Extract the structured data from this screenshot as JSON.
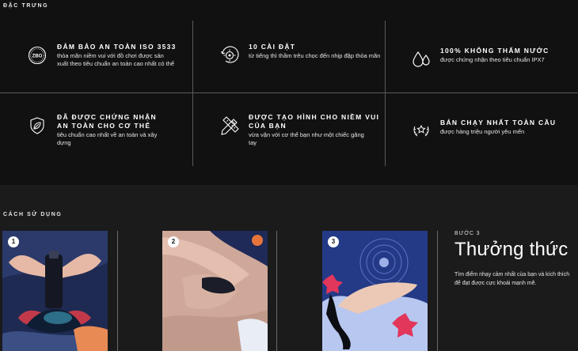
{
  "features_section": {
    "label": "ĐẶC TRƯNG",
    "items": [
      {
        "icon": "zbo-badge-icon",
        "title": "ĐẢM BẢO AN TOÀN ISO 3533",
        "desc": "thỏa mãn niềm vui với đồ chơi được sản xuất theo tiêu chuẩn an toàn cao nhất có thể",
        "badge_text": "ZBO"
      },
      {
        "icon": "settings-dial-icon",
        "title": "10 CÀI ĐẶT",
        "desc": "từ tiếng thì thầm trêu chọc đến nhịp đập thỏa mãn"
      },
      {
        "icon": "water-drops-icon",
        "title": "100% KHÔNG THẤM NƯỚC",
        "desc": "được chứng nhận theo tiêu chuẩn IPX7"
      },
      {
        "icon": "shield-leaf-icon",
        "title": "ĐÃ ĐƯỢC CHỨNG NHẬN AN TOÀN CHO CƠ THỂ",
        "desc": "tiêu chuẩn cao nhất về an toàn và xây dựng"
      },
      {
        "icon": "pencil-ruler-icon",
        "title": "ĐƯỢC TẠO HÌNH CHO NIỀM VUI CỦA BẠN",
        "desc": "vừa vặn với cơ thể bạn như một chiếc găng tay"
      },
      {
        "icon": "laurel-star-icon",
        "title": "BÁN CHẠY NHẤT TOÀN CẦU",
        "desc": "được hàng triệu người yêu mến"
      }
    ]
  },
  "usage_section": {
    "label": "CÁCH SỬ DỤNG",
    "steps": [
      {
        "badge": "1"
      },
      {
        "badge": "2"
      },
      {
        "badge": "3"
      }
    ],
    "caption": {
      "step_num": "BƯỚC 3",
      "title": "Thưởng thức",
      "desc": "Tìm điểm nhạy cảm nhất của bạn và kích thích để đạt được cực khoái mạnh mẽ."
    }
  },
  "colors": {
    "background": "#111112",
    "usage_background": "#1b1b1c",
    "divider": "#5a5a5a",
    "text": "#ffffff"
  }
}
